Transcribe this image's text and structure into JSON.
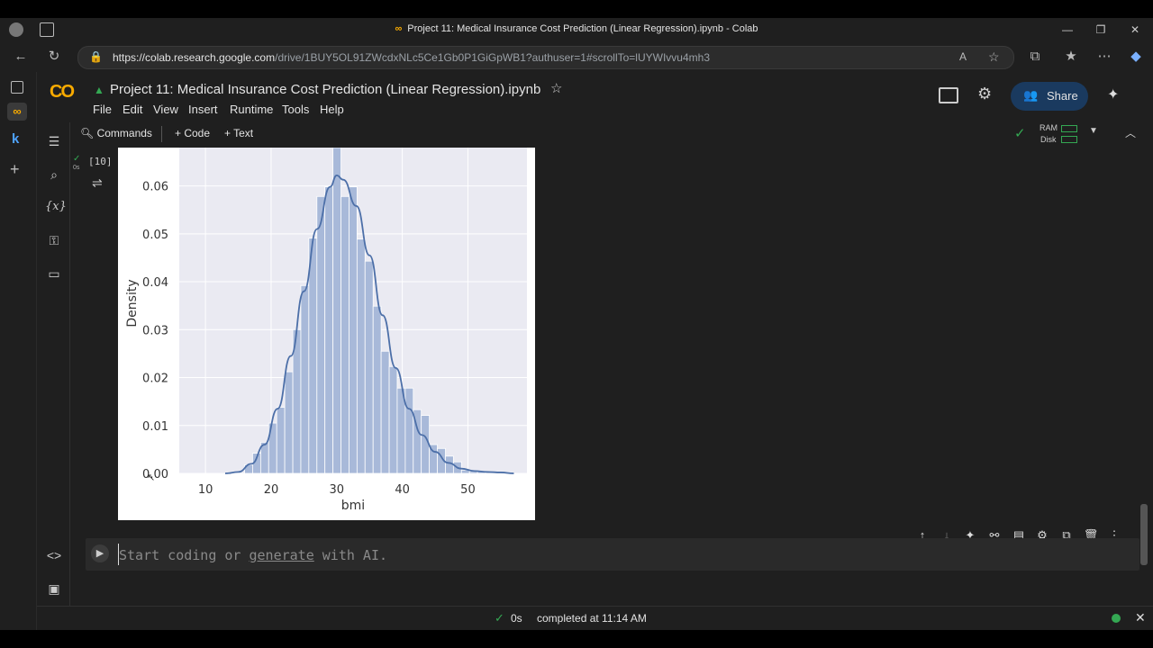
{
  "window": {
    "title": "Project 11: Medical Insurance Cost Prediction (Linear Regression).ipynb - Colab"
  },
  "browser": {
    "url_host": "https://colab.research.google.com",
    "url_path": "/drive/1BUY5OL91ZWcdxNLc5Ce1Gb0P1GiGpWB1?authuser=1#scrollTo=lUYWIvvu4mh3"
  },
  "notebook": {
    "logo": "CO",
    "title": "Project 11: Medical Insurance Cost Prediction (Linear Regression).ipynb",
    "menu": [
      "File",
      "Edit",
      "View",
      "Insert",
      "Runtime",
      "Tools",
      "Help"
    ],
    "share_label": "Share",
    "toolbar": {
      "commands": "Commands",
      "code": "+ Code",
      "text": "+ Text"
    },
    "ram_label": "RAM",
    "disk_label": "Disk"
  },
  "cell": {
    "exec_count": "[10]",
    "exec_time": "0s",
    "placeholder_pre": "Start coding or ",
    "placeholder_link": "generate",
    "placeholder_post": " with AI."
  },
  "status": {
    "time": "0s",
    "text": "completed at 11:14 AM"
  },
  "colors": {
    "accent": "#1a3a5f",
    "bar": "#a8b9d9",
    "kde": "#4c6fa8",
    "ok": "#34a853"
  },
  "chart_data": {
    "type": "bar",
    "xlabel": "bmi",
    "ylabel": "Density",
    "xlim": [
      6,
      59
    ],
    "ylim": [
      0,
      0.068
    ],
    "xticks": [
      10,
      20,
      30,
      40,
      50
    ],
    "yticks": [
      0.0,
      0.01,
      0.02,
      0.03,
      0.04,
      0.05,
      0.06
    ],
    "ytick_labels": [
      "0.00",
      "0.01",
      "0.02",
      "0.03",
      "0.04",
      "0.05",
      "0.06"
    ],
    "grid": true,
    "bins": [
      {
        "x0": 15.96,
        "x1": 17.18,
        "density": 0.0018
      },
      {
        "x0": 17.18,
        "x1": 18.41,
        "density": 0.0042
      },
      {
        "x0": 18.41,
        "x1": 19.63,
        "density": 0.0065
      },
      {
        "x0": 19.63,
        "x1": 20.86,
        "density": 0.0105
      },
      {
        "x0": 20.86,
        "x1": 22.08,
        "density": 0.0138
      },
      {
        "x0": 22.08,
        "x1": 23.31,
        "density": 0.0212
      },
      {
        "x0": 23.31,
        "x1": 24.53,
        "density": 0.03
      },
      {
        "x0": 24.53,
        "x1": 25.75,
        "density": 0.0392
      },
      {
        "x0": 25.75,
        "x1": 26.98,
        "density": 0.0491
      },
      {
        "x0": 26.98,
        "x1": 28.2,
        "density": 0.0578
      },
      {
        "x0": 28.2,
        "x1": 29.43,
        "density": 0.0598
      },
      {
        "x0": 29.43,
        "x1": 30.65,
        "density": 0.068
      },
      {
        "x0": 30.65,
        "x1": 31.88,
        "density": 0.0578
      },
      {
        "x0": 31.88,
        "x1": 33.1,
        "density": 0.0598
      },
      {
        "x0": 33.1,
        "x1": 34.32,
        "density": 0.0489
      },
      {
        "x0": 34.32,
        "x1": 35.55,
        "density": 0.0443
      },
      {
        "x0": 35.55,
        "x1": 36.77,
        "density": 0.0349
      },
      {
        "x0": 36.77,
        "x1": 38.0,
        "density": 0.0255
      },
      {
        "x0": 38.0,
        "x1": 39.22,
        "density": 0.0223
      },
      {
        "x0": 39.22,
        "x1": 40.45,
        "density": 0.0178
      },
      {
        "x0": 40.45,
        "x1": 41.67,
        "density": 0.0178
      },
      {
        "x0": 41.67,
        "x1": 42.89,
        "density": 0.0133
      },
      {
        "x0": 42.89,
        "x1": 44.12,
        "density": 0.0121
      },
      {
        "x0": 44.12,
        "x1": 45.34,
        "density": 0.006
      },
      {
        "x0": 45.34,
        "x1": 46.57,
        "density": 0.0052
      },
      {
        "x0": 46.57,
        "x1": 47.79,
        "density": 0.0036
      },
      {
        "x0": 47.79,
        "x1": 49.02,
        "density": 0.0024
      },
      {
        "x0": 49.02,
        "x1": 50.24,
        "density": 0.0007
      },
      {
        "x0": 50.24,
        "x1": 51.46,
        "density": 0.0004
      },
      {
        "x0": 51.46,
        "x1": 52.69,
        "density": 0.0004
      },
      {
        "x0": 52.69,
        "x1": 53.91,
        "density": 0.0003
      }
    ],
    "kde": [
      [
        13,
        0.0
      ],
      [
        15,
        0.0003
      ],
      [
        17,
        0.002
      ],
      [
        19,
        0.006
      ],
      [
        21,
        0.0135
      ],
      [
        23,
        0.0245
      ],
      [
        25,
        0.038
      ],
      [
        27,
        0.051
      ],
      [
        29,
        0.0598
      ],
      [
        30,
        0.0622
      ],
      [
        31,
        0.0613
      ],
      [
        33,
        0.0558
      ],
      [
        35,
        0.0455
      ],
      [
        37,
        0.033
      ],
      [
        39,
        0.022
      ],
      [
        41,
        0.0135
      ],
      [
        43,
        0.008
      ],
      [
        45,
        0.0045
      ],
      [
        47,
        0.0022
      ],
      [
        49,
        0.001
      ],
      [
        51,
        0.0005
      ],
      [
        53,
        0.0003
      ],
      [
        55,
        0.0002
      ],
      [
        57,
        0.0
      ]
    ]
  }
}
